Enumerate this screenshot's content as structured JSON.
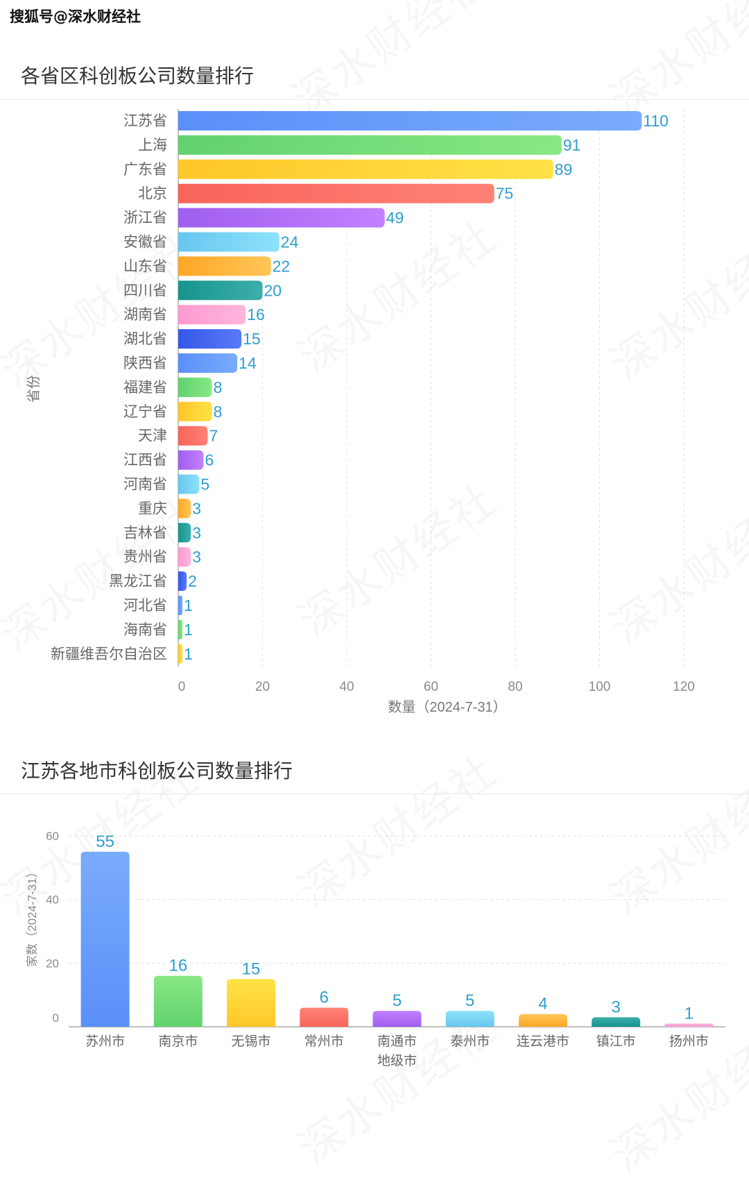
{
  "header": {
    "source_label": "搜狐号@深水财经社",
    "watermark": "深水财经社"
  },
  "palette": [
    {
      "from": "#5B8FF9",
      "to": "#79ACFB"
    },
    {
      "from": "#62D26F",
      "to": "#88E884"
    },
    {
      "from": "#FFC72A",
      "to": "#FFE246"
    },
    {
      "from": "#F8645A",
      "to": "#FF8276"
    },
    {
      "from": "#A05EEE",
      "to": "#C281FF"
    },
    {
      "from": "#68C6EE",
      "to": "#8CE2FB"
    },
    {
      "from": "#FFA726",
      "to": "#FFC658"
    },
    {
      "from": "#16948E",
      "to": "#3DAEAB"
    },
    {
      "from": "#FF9AD0",
      "to": "#FFB6DB"
    },
    {
      "from": "#3457E8",
      "to": "#587AF8"
    }
  ],
  "label_color": "#2E9ECF",
  "chart_data": [
    {
      "type": "bar",
      "orientation": "horizontal",
      "title": "各省区科创板公司数量排行",
      "categories": [
        "江苏省",
        "上海",
        "广东省",
        "北京",
        "浙江省",
        "安徽省",
        "山东省",
        "四川省",
        "湖南省",
        "湖北省",
        "陕西省",
        "福建省",
        "辽宁省",
        "天津",
        "江西省",
        "河南省",
        "重庆",
        "吉林省",
        "贵州省",
        "黑龙江省",
        "河北省",
        "海南省",
        "新疆维吾尔自治区"
      ],
      "values": [
        110,
        91,
        89,
        75,
        49,
        24,
        22,
        20,
        16,
        15,
        14,
        8,
        8,
        7,
        6,
        5,
        3,
        3,
        3,
        2,
        1,
        1,
        1
      ],
      "xlabel": "数量（2024-7-31）",
      "ylabel": "省份",
      "xlim": [
        0,
        120
      ],
      "xticks": [
        0,
        20,
        40,
        60,
        80,
        100,
        120
      ],
      "grid": true,
      "legend": "none",
      "data_labels": true
    },
    {
      "type": "bar",
      "orientation": "vertical",
      "title": "江苏各地市科创板公司数量排行",
      "categories": [
        "苏州市",
        "南京市",
        "无锡市",
        "常州市",
        "南通市",
        "泰州市",
        "连云港市",
        "镇江市",
        "扬州市"
      ],
      "values": [
        55,
        16,
        15,
        6,
        5,
        5,
        4,
        3,
        1
      ],
      "xlabel": "地级市",
      "ylabel": "家数（2024-7-31）",
      "ylim": [
        0,
        60
      ],
      "yticks": [
        0,
        20,
        40,
        60
      ],
      "grid": true,
      "legend": "none",
      "data_labels": true
    }
  ]
}
